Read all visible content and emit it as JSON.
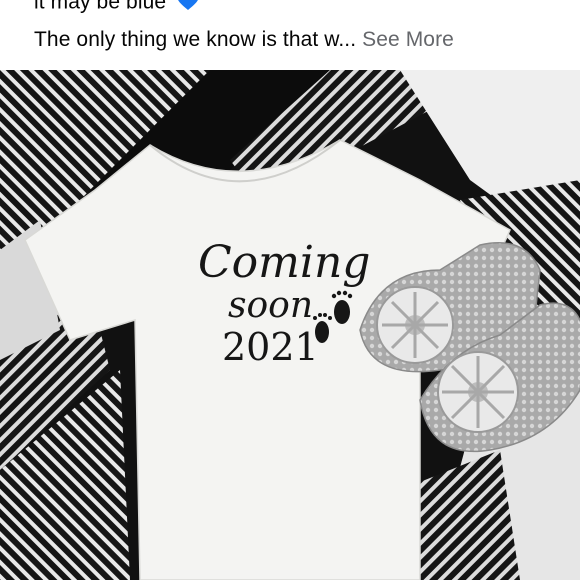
{
  "post": {
    "caption_line_1": "it may be blue",
    "caption_line_1_emoji": "blue-heart-icon",
    "caption_line_2": "The only thing we know is that w...",
    "see_more_label": "See More"
  },
  "photo": {
    "onesie_print": {
      "line1": "Coming",
      "line2": "soon",
      "line3": "2021"
    }
  },
  "colors": {
    "text_primary": "#050505",
    "see_more": "#65676b",
    "heart": "#1877f2"
  }
}
